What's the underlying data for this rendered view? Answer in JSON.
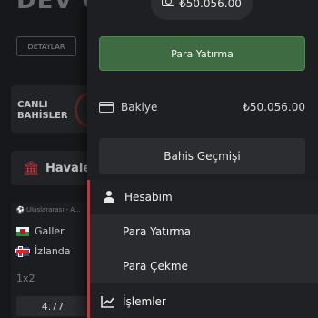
{
  "background": {
    "title": "DEV O",
    "details_button": "DETAYLAR",
    "live_bets_label": "CANLI BAHİSLER",
    "havale_label": "Havale",
    "match": {
      "league": "Uluslararası - A...",
      "team1": "Galler",
      "team2": "İzlanda",
      "market": "1x2",
      "odd": "4.77"
    }
  },
  "panel": {
    "balance_pill": "₺50.056.00",
    "deposit_button": "Para Yatırma",
    "bakiye_label": "Bakiye",
    "bakiye_value": "₺50.056.00",
    "history_button": "Bahis Geçmişi",
    "menu": {
      "account": "Hesabım",
      "deposit": "Para Yatırma",
      "withdraw": "Para Çekme",
      "transactions": "İşlemler"
    }
  },
  "colors": {
    "accent_red": "#c0343d",
    "deposit_green": "#3f6b43",
    "panel_bg": "#1e1f23"
  },
  "icons": [
    "wallet-icon",
    "card-icon",
    "user-icon",
    "chart-icon",
    "bank-icon",
    "soccer-ball-icon"
  ]
}
